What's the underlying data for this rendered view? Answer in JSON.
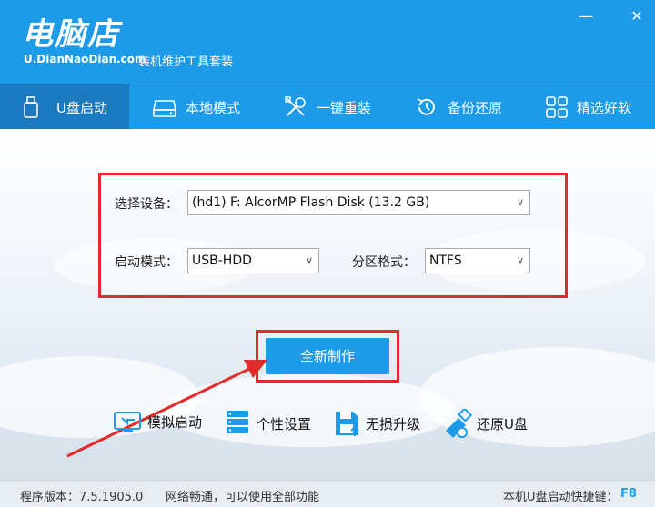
{
  "header": {
    "logo_main": "电脑店",
    "logo_sub": "U.DianNaoDian.com",
    "slogan": "装机维护工具套装",
    "min_glyph": "—",
    "close_glyph": "✕"
  },
  "nav": [
    {
      "label": "U盘启动",
      "icon": "usb-drive-icon",
      "active": true
    },
    {
      "label": "本地模式",
      "icon": "hard-disk-icon",
      "active": false
    },
    {
      "label": "一键重装",
      "icon": "tools-icon",
      "active": false
    },
    {
      "label": "备份还原",
      "icon": "restore-icon",
      "active": false
    },
    {
      "label": "精选好软",
      "icon": "apps-grid-icon",
      "active": false
    }
  ],
  "form": {
    "device_label": "选择设备：",
    "device_value": "(hd1) F: AlcorMP Flash Disk (13.2 GB)",
    "boot_mode_label": "启动模式：",
    "boot_mode_value": "USB-HDD",
    "partition_label": "分区格式：",
    "partition_value": "NTFS"
  },
  "make_button": "全新制作",
  "tools": [
    {
      "label": "模拟启动",
      "icon": "simulate-boot-icon"
    },
    {
      "label": "个性设置",
      "icon": "server-settings-icon"
    },
    {
      "label": "无损升级",
      "icon": "upgrade-icon"
    },
    {
      "label": "还原U盘",
      "icon": "restore-usb-icon"
    }
  ],
  "status": {
    "version": "程序版本：7.5.1905.0",
    "network": "网络畅通，可以使用全部功能",
    "hotkey_label": "本机U盘启动快捷键：",
    "hotkey_value": "F8"
  },
  "colors": {
    "primary": "#1e9be8",
    "active_tab": "#1b79c0",
    "highlight": "#e32b2b"
  }
}
